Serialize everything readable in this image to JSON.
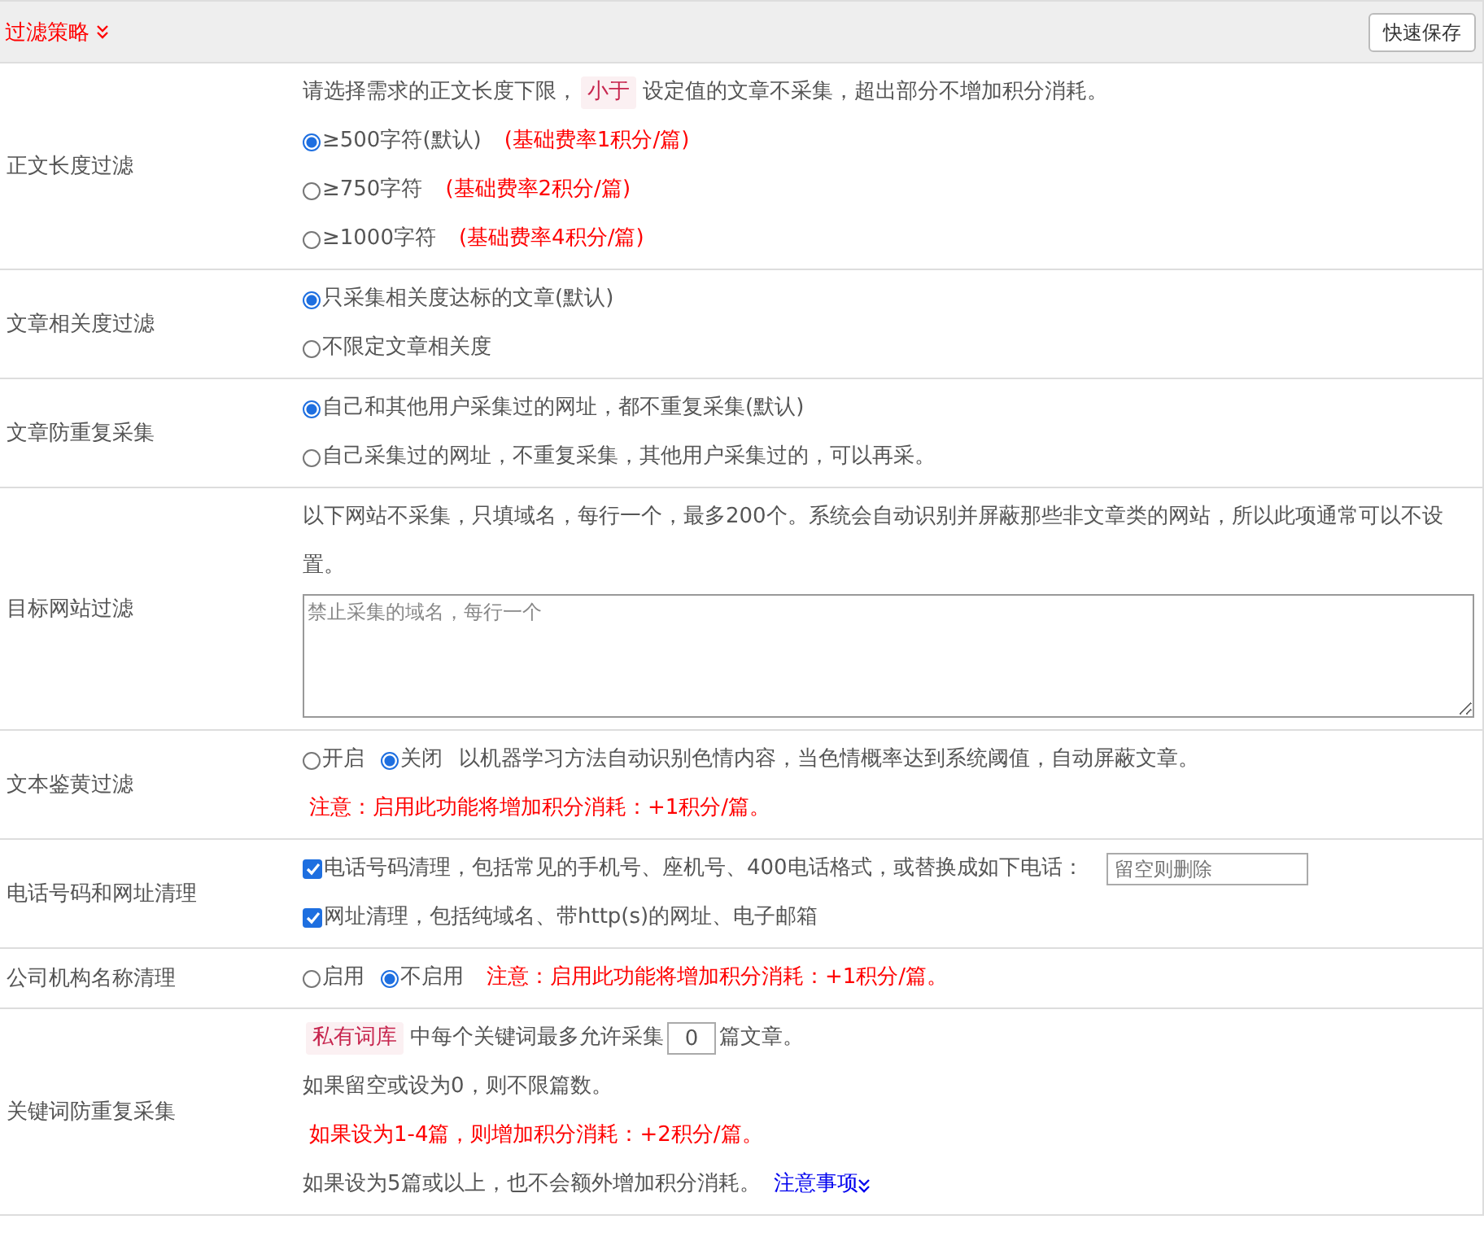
{
  "header": {
    "title": "过滤策略",
    "save_button": "快速保存"
  },
  "sections": [
    {
      "label": "正文长度过滤",
      "lines": [
        [
          {
            "kind": "text",
            "text": "请选择需求的正文长度下限，"
          },
          {
            "kind": "tag",
            "text": "小于"
          },
          {
            "kind": "text",
            "text": "设定值的文章不采集，超出部分不增加积分消耗。"
          }
        ],
        [
          {
            "kind": "radio",
            "text": "≥500字符(默认)",
            "selected": true
          },
          {
            "kind": "note",
            "text": "(基础费率1积分/篇)"
          }
        ],
        [
          {
            "kind": "radio",
            "text": "≥750字符",
            "selected": false
          },
          {
            "kind": "note",
            "text": "(基础费率2积分/篇)"
          }
        ],
        [
          {
            "kind": "radio",
            "text": "≥1000字符",
            "selected": false
          },
          {
            "kind": "note",
            "text": "(基础费率4积分/篇)"
          }
        ]
      ]
    },
    {
      "label": "文章相关度过滤",
      "lines": [
        [
          {
            "kind": "radio",
            "text": "只采集相关度达标的文章(默认)",
            "selected": true
          }
        ],
        [
          {
            "kind": "radio",
            "text": "不限定文章相关度",
            "selected": false
          }
        ]
      ]
    },
    {
      "label": "文章防重复采集",
      "lines": [
        [
          {
            "kind": "radio",
            "text": "自己和其他用户采集过的网址，都不重复采集(默认)",
            "selected": true
          }
        ],
        [
          {
            "kind": "radio",
            "text": "自己采集过的网址，不重复采集，其他用户采集过的，可以再采。",
            "selected": false
          }
        ]
      ]
    },
    {
      "label": "目标网站过滤",
      "lines": [
        [
          {
            "kind": "text",
            "text": "以下网站不采集，只填域名，每行一个，最多200个。系统会自动识别并屏蔽那些非文章类的网站，所以此项通常可以不设置。"
          }
        ],
        [
          {
            "kind": "textarea",
            "placeholder": "禁止采集的域名，每行一个"
          }
        ]
      ]
    },
    {
      "label": "文本鉴黄过滤",
      "lines": [
        [
          {
            "kind": "radio",
            "text": "开启",
            "selected": false
          },
          {
            "kind": "radio",
            "text": "关闭",
            "selected": true
          },
          {
            "kind": "text",
            "text": "以机器学习方法自动识别色情内容，当色情概率达到系统阈值，自动屏蔽文章。"
          }
        ],
        [
          {
            "kind": "note",
            "text": "注意：启用此功能将增加积分消耗：+1积分/篇。"
          }
        ]
      ]
    },
    {
      "label": "电话号码和网址清理",
      "lines": [
        [
          {
            "kind": "checkbox",
            "text": "电话号码清理，包括常见的手机号、座机号、400电话格式，或替换成如下电话：",
            "checked": true
          },
          {
            "kind": "input",
            "placeholder": "留空则删除"
          }
        ],
        [
          {
            "kind": "checkbox",
            "text": "网址清理，包括纯域名、带http(s)的网址、电子邮箱",
            "checked": true
          }
        ]
      ]
    },
    {
      "label": "公司机构名称清理",
      "lines": [
        [
          {
            "kind": "radio",
            "text": "启用",
            "selected": false
          },
          {
            "kind": "radio",
            "text": "不启用",
            "selected": true
          },
          {
            "kind": "note",
            "text": "注意：启用此功能将增加积分消耗：+1积分/篇。"
          }
        ]
      ]
    },
    {
      "label": "关键词防重复采集",
      "lines": [
        [
          {
            "kind": "tag",
            "text": "私有词库"
          },
          {
            "kind": "text",
            "text": "中每个关键词最多允许采集"
          },
          {
            "kind": "number",
            "value": "0"
          },
          {
            "kind": "text",
            "text": "篇文章。"
          }
        ],
        [
          {
            "kind": "text",
            "text": "如果留空或设为0，则不限篇数。"
          }
        ],
        [
          {
            "kind": "note",
            "text": "如果设为1-4篇，则增加积分消耗：+2积分/篇。"
          }
        ],
        [
          {
            "kind": "text",
            "text": "如果设为5篇或以上，也不会额外增加积分消耗。"
          },
          {
            "kind": "link",
            "text": "注意事项"
          }
        ]
      ]
    }
  ]
}
